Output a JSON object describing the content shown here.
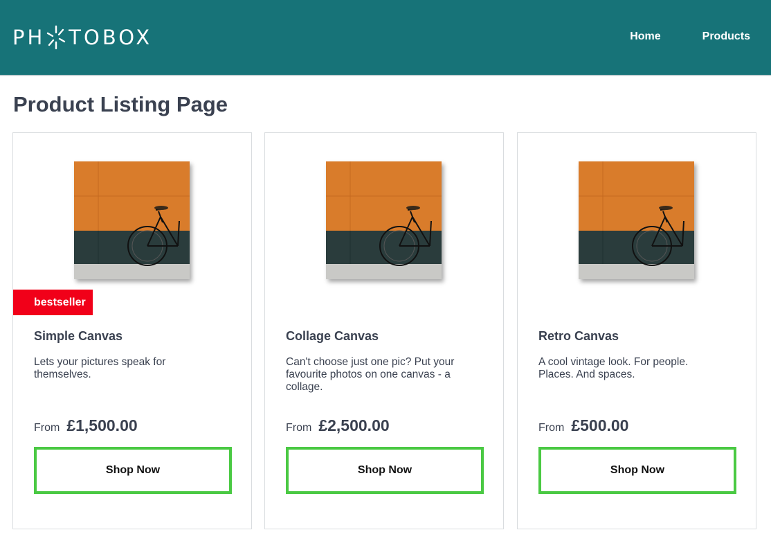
{
  "header": {
    "logo_text_left": "PH",
    "logo_text_right": "TOBOX",
    "nav": [
      {
        "label": "Home"
      },
      {
        "label": "Products"
      }
    ],
    "background": "#177378"
  },
  "page": {
    "title": "Product Listing Page"
  },
  "products": [
    {
      "badge": "bestseller",
      "title": "Simple Canvas",
      "description": "Lets your pictures speak for themselves.",
      "price_prefix": "From",
      "price": "£1,500.00",
      "cta": "Shop Now"
    },
    {
      "badge": "",
      "title": "Collage Canvas",
      "description": "Can't choose just one pic? Put your favourite photos on one canvas - a collage.",
      "price_prefix": "From",
      "price": "£2,500.00",
      "cta": "Shop Now"
    },
    {
      "badge": "",
      "title": "Retro Canvas",
      "description": "A cool vintage look. For people. Places. And spaces.",
      "price_prefix": "From",
      "price": "£500.00",
      "cta": "Shop Now"
    }
  ],
  "colors": {
    "accent": "#4ac943",
    "badge": "#f10019",
    "text": "#3a4150"
  }
}
